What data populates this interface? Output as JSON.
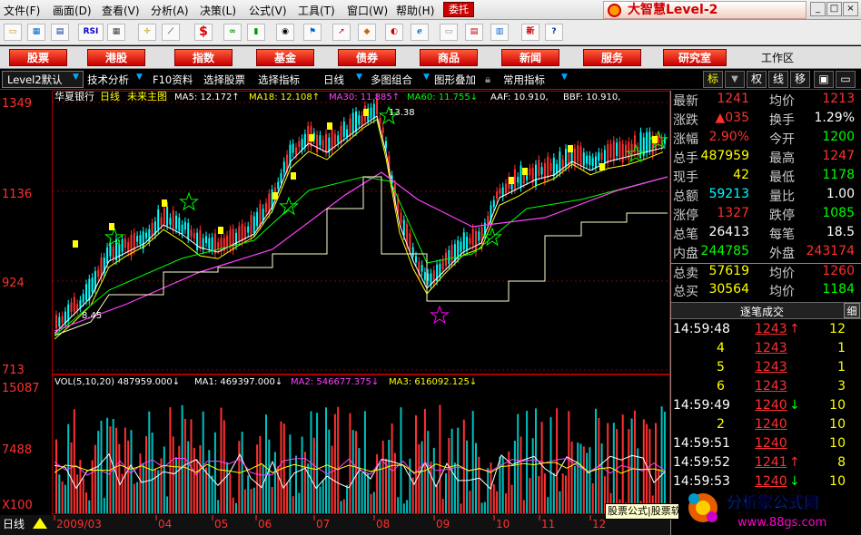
{
  "menu": [
    "文件(F)",
    "画面(D)",
    "查看(V)",
    "分析(A)",
    "决策(L)",
    "公式(V)",
    "工具(T)",
    "窗口(W)",
    "帮助(H)"
  ],
  "weituo": "委托",
  "brand": "大智慧Level-2",
  "window_buttons": [
    "_",
    "□",
    "×"
  ],
  "toolbar_icons": [
    "open-icon",
    "chart-icon",
    "screen-icon",
    "rsi-icon",
    "grid-icon",
    "crosshair-icon",
    "ruler-icon",
    "dollar-icon",
    "glasses-icon",
    "bars-icon",
    "binoculars-icon",
    "flag-icon",
    "arrow-icon",
    "diamond-icon",
    "sound-icon",
    "ie-icon",
    "news-icon",
    "note-icon",
    "window-icon",
    "book-icon",
    "new-icon",
    "help-icon"
  ],
  "toolbar_labels": {
    "rsi": "RSI",
    "new": "新"
  },
  "categories": [
    "股票",
    "港股",
    "指数",
    "基金",
    "债券",
    "商品",
    "新闻",
    "服务",
    "研究室"
  ],
  "workzone": "工作区",
  "subtools": [
    "Level2默认",
    "技术分析",
    "F10资料",
    "选择股票",
    "选择指标",
    "日线",
    "多图组合",
    "图形叠加",
    "常用指标"
  ],
  "right_tabs": [
    "标",
    "权",
    "线",
    "移"
  ],
  "chart": {
    "stock_name": "华夏银行",
    "period": "日线",
    "template": "未来主图",
    "ma_labels": [
      "MA5: 12.172↑",
      "MA18: 12.108↑",
      "MA30: 11.885↑",
      "MA60: 11.755↓",
      "AAF: 10.910,",
      "BBF: 10.910,"
    ],
    "ma_colors": [
      "#ffffff",
      "#ffff00",
      "#ff40ff",
      "#00ff00",
      "#ffffff",
      "#ffffff"
    ],
    "price_ticks": [
      "1349",
      "1136",
      "924",
      "713"
    ],
    "high_label": "13.38",
    "low_label": "8.45",
    "vol_labels": [
      "VOL(5,10,20) 487959.000↓",
      "MA1: 469397.000↓",
      "MA2: 546677.375↓",
      "MA3: 616092.125↓"
    ],
    "vol_ticks": [
      "15087",
      "7488",
      "X100"
    ],
    "date_ticks": [
      "2009/03",
      "04",
      "05",
      "06",
      "07",
      "08",
      "09",
      "10",
      "11",
      "12"
    ],
    "date_bar_prefix": "日线"
  },
  "quote": {
    "rows": [
      {
        "l": "最新",
        "v": "1241",
        "l2": "均价",
        "v2": "1213",
        "c": "#ff3030",
        "c2": "#ff3030"
      },
      {
        "l": "涨跌",
        "v": "▲035",
        "l2": "换手",
        "v2": "1.29%",
        "c": "#ff3030",
        "c2": "#ffffff"
      },
      {
        "l": "涨幅",
        "v": "2.90%",
        "l2": "今开",
        "v2": "1200",
        "c": "#ff3030",
        "c2": "#00ff00"
      },
      {
        "l": "总手",
        "v": "487959",
        "l2": "最高",
        "v2": "1247",
        "c": "#ffff00",
        "c2": "#ff3030"
      },
      {
        "l": "现手",
        "v": "42",
        "l2": "最低",
        "v2": "1178",
        "c": "#ffff00",
        "c2": "#00ff00"
      },
      {
        "l": "总额",
        "v": "59213",
        "l2": "量比",
        "v2": "1.00",
        "c": "#00ffff",
        "c2": "#ffffff"
      },
      {
        "l": "涨停",
        "v": "1327",
        "l2": "跌停",
        "v2": "1085",
        "c": "#ff3030",
        "c2": "#00ff00"
      },
      {
        "l": "总笔",
        "v": "26413",
        "l2": "每笔",
        "v2": "18.5",
        "c": "#ffffff",
        "c2": "#ffffff"
      },
      {
        "l": "内盘",
        "v": "244785",
        "l2": "外盘",
        "v2": "243174",
        "c": "#00ff00",
        "c2": "#ff3030"
      },
      {
        "l": "总卖",
        "v": "57619",
        "l2": "均价",
        "v2": "1260",
        "c": "#ffff00",
        "c2": "#ff3030"
      },
      {
        "l": "总买",
        "v": "30564",
        "l2": "均价",
        "v2": "1184",
        "c": "#ffff00",
        "c2": "#00ff00"
      }
    ],
    "tick_header": "逐笔成交",
    "tick_tab": "细",
    "ticks": [
      {
        "t": "14:59:48",
        "p": "1243",
        "a": "↑",
        "v": "12"
      },
      {
        "t": "4",
        "p": "1243",
        "a": "",
        "v": "1"
      },
      {
        "t": "5",
        "p": "1243",
        "a": "",
        "v": "1"
      },
      {
        "t": "6",
        "p": "1243",
        "a": "",
        "v": "3"
      },
      {
        "t": "14:59:49",
        "p": "1240",
        "a": "↓",
        "v": "10"
      },
      {
        "t": "2",
        "p": "1240",
        "a": "",
        "v": "10"
      },
      {
        "t": "14:59:51",
        "p": "1240",
        "a": "",
        "v": "10"
      },
      {
        "t": "14:59:52",
        "p": "1241",
        "a": "↑",
        "v": "8"
      },
      {
        "t": "14:59:53",
        "p": "1240",
        "a": "↓",
        "v": "10"
      }
    ]
  },
  "tooltip": "股票公式|股票软件",
  "watermark": {
    "title": "分析家公式网",
    "url": "www.88gs.com"
  }
}
